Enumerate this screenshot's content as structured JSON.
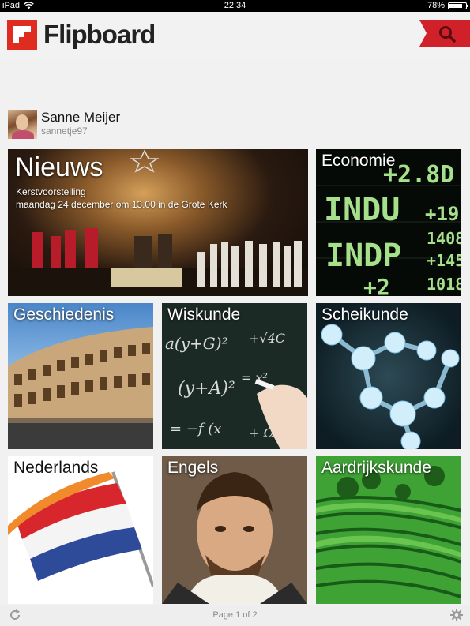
{
  "status_bar": {
    "device": "iPad",
    "time": "22:34",
    "battery_text": "78%",
    "battery_level": 0.78
  },
  "header": {
    "app_name": "Flipboard",
    "brand_color": "#e02b20",
    "search_icon": "search-icon"
  },
  "profile": {
    "name": "Sanne Meijer",
    "handle": "sannetje97"
  },
  "tiles": {
    "nieuws": {
      "title": "Nieuws",
      "line1": "Kerstvoorstelling",
      "line2": "maandag 24 december om 13.00 in de Grote Kerk"
    },
    "economie": {
      "title": "Economie"
    },
    "geschiedenis": {
      "title": "Geschiedenis"
    },
    "wiskunde": {
      "title": "Wiskunde"
    },
    "scheikunde": {
      "title": "Scheikunde"
    },
    "nederlands": {
      "title": "Nederlands"
    },
    "engels": {
      "title": "Engels"
    },
    "aardrijkskunde": {
      "title": "Aardrijkskunde"
    }
  },
  "footer": {
    "page_indicator": "Page 1 of 2",
    "refresh_icon": "refresh-icon",
    "settings_icon": "gear-icon"
  }
}
